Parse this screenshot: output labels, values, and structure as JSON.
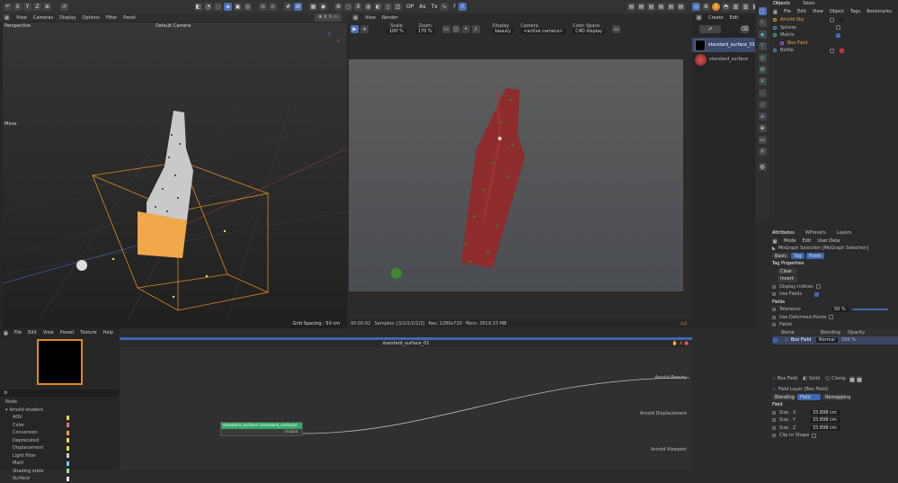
{
  "top_toolbar": {
    "axis_labels": [
      "X",
      "Y",
      "Z"
    ],
    "tool_labels": [
      "OP",
      "As",
      "Tx",
      "?"
    ]
  },
  "viewport": {
    "menu": [
      "View",
      "Cameras",
      "Display",
      "Options",
      "Filter",
      "Panel"
    ],
    "projection": "Perspective",
    "camera": "Default Camera",
    "move_label": "Move",
    "grid_spacing": "Grid Spacing : 50 cm"
  },
  "render_view": {
    "menu": [
      "View",
      "Render"
    ],
    "scale_label": "Scale",
    "scale_value": "100 %",
    "zoom_label": "Zoom",
    "zoom_value": "170 %",
    "display_label": "Display",
    "display_value": "beauty",
    "camera_label": "Camera",
    "camera_value": "<active camera>",
    "colorspace_label": "Color Space",
    "colorspace_value": "C4D display",
    "status_time": "00:00:02",
    "status_samples": "Samples: [3/2/2/2/2/2]",
    "status_res": "Res: 1280x720",
    "status_mem": "Mem: 3819.33 MB",
    "warning_count": "2"
  },
  "materials": {
    "menu": [
      "Create",
      "Edit"
    ],
    "items": [
      {
        "label": "standard_surface_01",
        "selected": true
      },
      {
        "label": "standard_surface",
        "selected": false
      }
    ]
  },
  "object_manager": {
    "tabs": [
      "Objects",
      "Takes"
    ],
    "menu": [
      "File",
      "Edit",
      "View",
      "Object",
      "Tags",
      "Bookmarks"
    ],
    "items": [
      {
        "label": "Arnold Sky",
        "indent": 0,
        "color": "#e8a33a"
      },
      {
        "label": "Sphere",
        "indent": 0,
        "color": "#cfcfcf"
      },
      {
        "label": "Matrix",
        "indent": 0,
        "color": "#cfcfcf"
      },
      {
        "label": "Box Field",
        "indent": 1,
        "color": "#e8a33a"
      },
      {
        "label": "Bottle",
        "indent": 0,
        "color": "#cfcfcf"
      }
    ]
  },
  "attributes": {
    "tabs": [
      "Attributes",
      "WPresets",
      "Layers"
    ],
    "menu": [
      "Mode",
      "Edit",
      "User Data"
    ],
    "object_title": "MoGraph Selection [MoGraph Selection]",
    "subtabs": [
      "Basic",
      "Tag",
      "Fields"
    ],
    "tag_properties_heading": "Tag Properties",
    "clear_button": "Clear",
    "invert_button": "Invert",
    "display_indices_label": "Display Indices",
    "use_fields_label": "Use Fields",
    "fields_heading": "Fields",
    "tolerance_label": "Tolerance",
    "tolerance_value": "50 %",
    "use_deformed_label": "Use Deformed Points",
    "fields_label": "Fields",
    "col_name": "Name",
    "col_blending": "Blending",
    "col_opacity": "Opacity",
    "field_name": "Box Field",
    "field_blend": "Normal",
    "field_opacity": "100 %",
    "boxfield_tools": [
      "Box Field",
      "Solid",
      "Clamp"
    ],
    "field_layer_title": "Field Layer [Box Field]",
    "layer_tabs": [
      "Blending",
      "Field",
      "Remapping"
    ],
    "field_heading": "Field",
    "size_x_label": "Size . X",
    "size_x_value": "33.898 cm",
    "size_y_label": "Size . Y",
    "size_y_value": "33.898 cm",
    "size_z_label": "Size . Z",
    "size_z_value": "33.898 cm",
    "clip_label": "Clip to Shape"
  },
  "node_browser": {
    "menu": [
      "File",
      "Edit",
      "View",
      "Preset",
      "Texture",
      "Help"
    ],
    "node_label": "Node",
    "root": "Arnold shaders",
    "categories": [
      {
        "label": "AOV",
        "color": "#e8d84a"
      },
      {
        "label": "Color",
        "color": "#e06a8a"
      },
      {
        "label": "Conversion",
        "color": "#e8a33a"
      },
      {
        "label": "Deprecated",
        "color": "#e8d84a"
      },
      {
        "label": "Displacement",
        "color": "#e8d84a"
      },
      {
        "label": "Light filter",
        "color": "#cfcfcf"
      },
      {
        "label": "Math",
        "color": "#8ac8e8"
      },
      {
        "label": "Shading state",
        "color": "#8ae88a"
      },
      {
        "label": "Surface",
        "color": "#e8e8e8"
      }
    ]
  },
  "node_editor": {
    "title": "standard_surface_01",
    "node_title": "standard_surface (standard_surface)",
    "node_output": "Output",
    "ports": [
      "Arnold Beauty",
      "Arnold Displacement",
      "Arnold Viewport"
    ]
  }
}
